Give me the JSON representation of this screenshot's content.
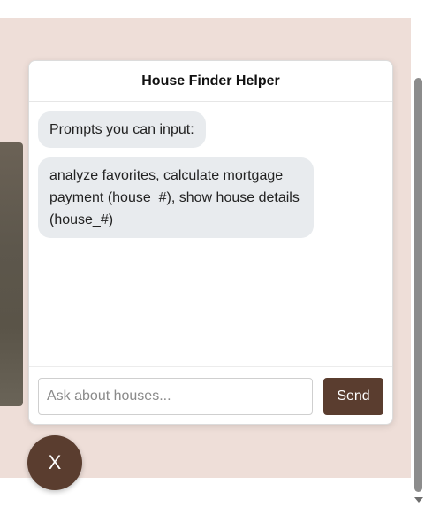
{
  "chat": {
    "title": "House Finder Helper",
    "messages": [
      {
        "text": "Prompts you can input:"
      },
      {
        "text": "analyze favorites, calculate mortgage payment (house_#), show house details (house_#)"
      }
    ],
    "input": {
      "placeholder": "Ask about houses...",
      "value": ""
    },
    "send_label": "Send"
  },
  "toggle": {
    "close_label": "X"
  },
  "colors": {
    "page_background": "#eeded8",
    "accent": "#5a3d2f",
    "bubble": "#e8ebee"
  }
}
